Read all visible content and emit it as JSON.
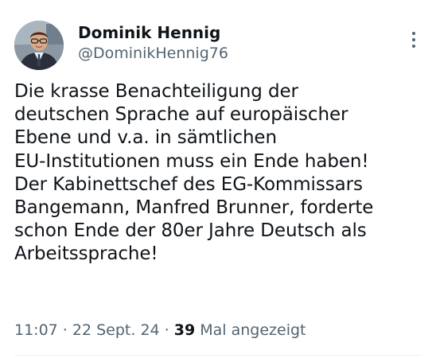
{
  "author": {
    "display_name": "Dominik Hennig",
    "handle": "@DominikHennig76",
    "avatar_icon": "profile-photo"
  },
  "tweet": {
    "text": "Die krasse Benachteiligung der\ndeutschen Sprache auf europäischer\nEbene und v.a. in sämtlichen\nEU-Institutionen muss ein Ende haben!\nDer Kabinettschef des EG-Kommissars\nBangemann, Manfred Brunner, forderte\nschon Ende der 80er Jahre Deutsch als\nArbeitssprache!"
  },
  "meta": {
    "time": "11:07",
    "separator_1": " · ",
    "date": "22 Sept. 24",
    "separator_2": " · ",
    "views_count": "39",
    "views_label": " Mal angezeigt"
  },
  "icons": {
    "more": "more-vertical-icon"
  },
  "colors": {
    "text_primary": "#0f1419",
    "text_secondary": "#536471",
    "divider": "#eff3f4",
    "background": "#ffffff"
  }
}
